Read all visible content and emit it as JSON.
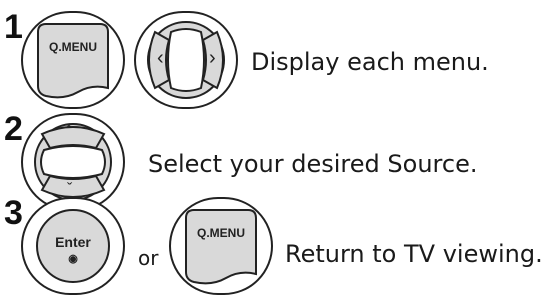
{
  "steps": [
    {
      "number": "1",
      "description": "Display each menu."
    },
    {
      "number": "2",
      "description": "Select your desired Source."
    },
    {
      "number": "3",
      "description": "Return to TV viewing."
    }
  ],
  "buttons": {
    "qmenu_label": "Q.MENU",
    "enter_label": "Enter",
    "enter_dot": "◉",
    "or_text": "or"
  },
  "colors": {
    "outline": "#222222",
    "button_fill": "#d9d9d9",
    "inner_fill": "#ffffff"
  }
}
